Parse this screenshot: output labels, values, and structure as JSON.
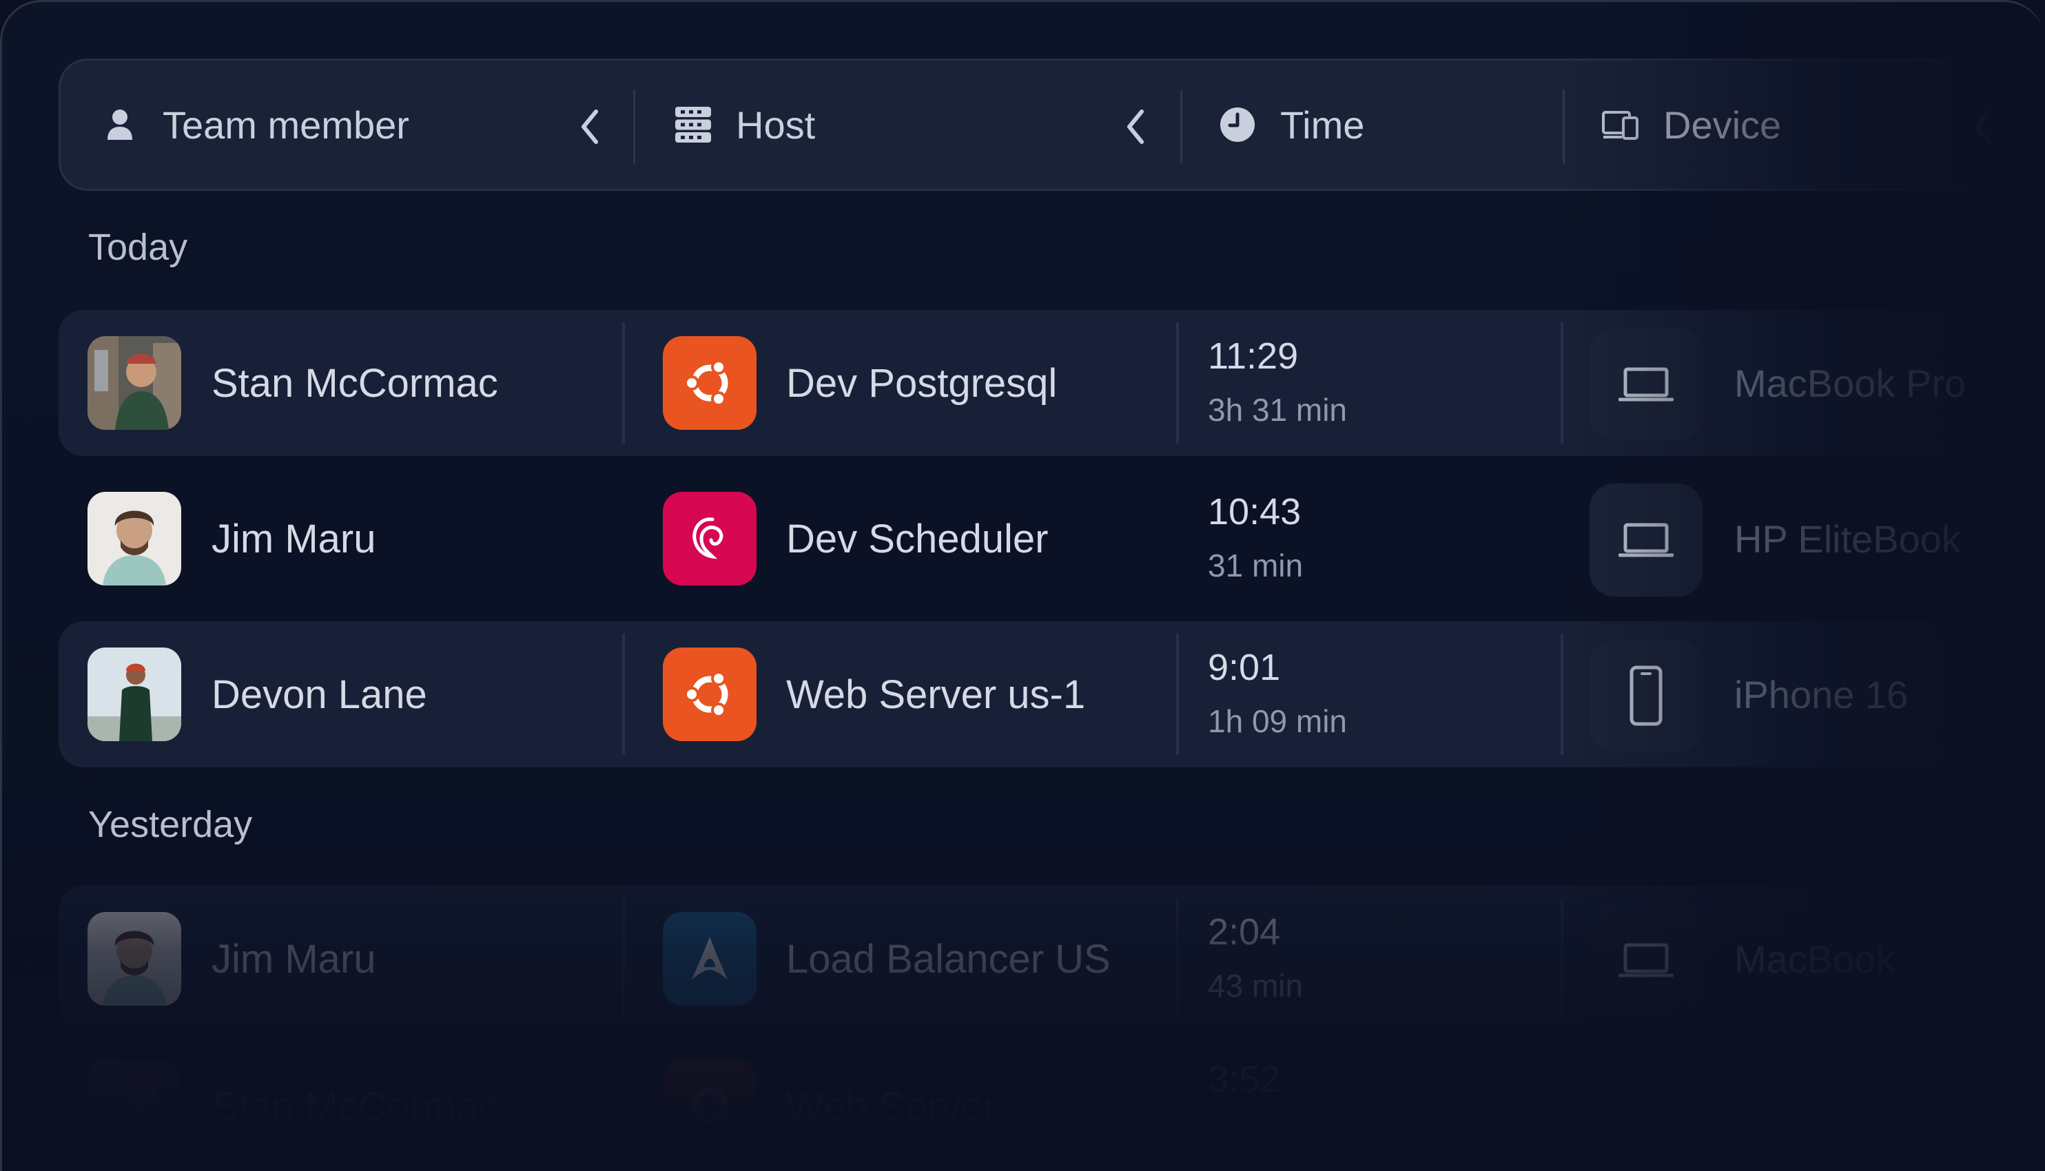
{
  "columns": {
    "team_member": "Team member",
    "host": "Host",
    "time": "Time",
    "device": "Device"
  },
  "sections": {
    "today": "Today",
    "yesterday": "Yesterday"
  },
  "rows": [
    {
      "member": "Stan McCormac",
      "host": "Dev Postgresql",
      "host_icon": "ubuntu-icon",
      "time": "11:29",
      "duration": "3h 31 min",
      "device": "MacBook Pro",
      "device_icon": "laptop-icon"
    },
    {
      "member": "Jim Maru",
      "host": "Dev Scheduler",
      "host_icon": "debian-icon",
      "time": "10:43",
      "duration": "31 min",
      "device": "HP EliteBook",
      "device_icon": "laptop-icon"
    },
    {
      "member": "Devon Lane",
      "host": "Web Server us-1",
      "host_icon": "ubuntu-icon",
      "time": "9:01",
      "duration": "1h 09 min",
      "device": "iPhone 16",
      "device_icon": "phone-icon"
    },
    {
      "member": "Jim Maru",
      "host": "Load Balancer US",
      "host_icon": "arch-icon",
      "time": "2:04",
      "duration": "43 min",
      "device": "MacBook",
      "device_icon": "laptop-icon"
    },
    {
      "member": "Stan McCormac",
      "host": "Web Server",
      "host_icon": "ubuntu-icon",
      "time": "3:52",
      "duration": "",
      "device": "",
      "device_icon": "laptop-icon"
    }
  ],
  "colors": {
    "ubuntu": "#e95420",
    "debian": "#d70751",
    "arch": "#1a5f8f",
    "background": "#0b1022",
    "row_alt": "#182037"
  }
}
